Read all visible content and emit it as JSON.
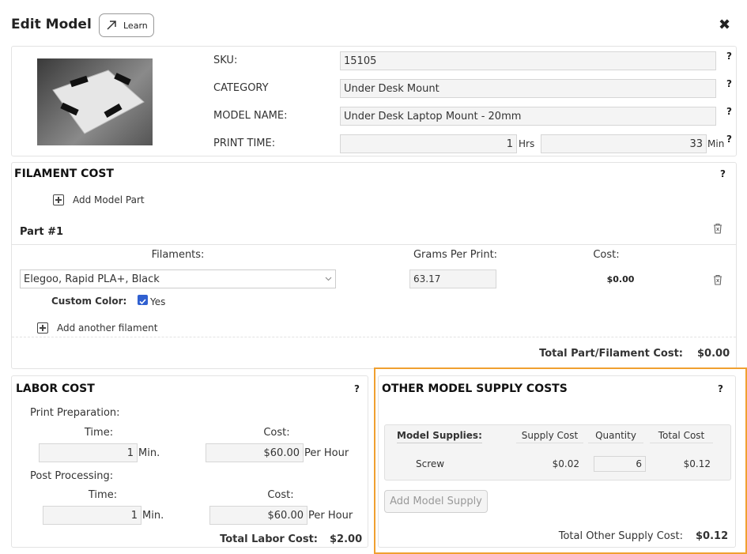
{
  "header": {
    "title": "Edit Model",
    "learn_label": "Learn",
    "close_symbol": "✖"
  },
  "info": {
    "sku_label": "SKU:",
    "sku_value": "15105",
    "category_label": "CATEGORY",
    "category_value": "Under Desk Mount",
    "model_name_label": "MODEL NAME:",
    "model_name_value": "Under Desk Laptop Mount - 20mm",
    "print_time_label": "PRINT TIME:",
    "hours_value": "1",
    "hours_unit": "Hrs",
    "minutes_value": "33",
    "minutes_unit": "Min",
    "help": "?"
  },
  "filament": {
    "title": "FILAMENT COST",
    "help": "?",
    "add_part_label": "Add Model Part",
    "part_title": "Part #1",
    "col_filaments": "Filaments:",
    "col_grams": "Grams Per Print:",
    "col_cost": "Cost:",
    "filament_selected": "Elegoo, Rapid PLA+, Black",
    "grams_value": "63.17",
    "cost_value": "$0.00",
    "custom_color_label": "Custom Color:",
    "custom_color_value": "Yes",
    "add_filament_label": "Add another filament",
    "total_label": "Total Part/Filament Cost:",
    "total_value": "$0.00"
  },
  "labor": {
    "title": "LABOR COST",
    "help": "?",
    "prep_label": "Print Preparation:",
    "time_label": "Time:",
    "cost_label": "Cost:",
    "prep_time": "1",
    "prep_time_unit": "Min.",
    "prep_cost": "$60.00",
    "prep_cost_unit": "Per Hour",
    "post_label": "Post Processing:",
    "post_time": "1",
    "post_time_unit": "Min.",
    "post_cost": "$60.00",
    "post_cost_unit": "Per Hour",
    "total_label": "Total Labor Cost:",
    "total_value": "$2.00"
  },
  "supplies": {
    "title": "OTHER MODEL SUPPLY COSTS",
    "help": "?",
    "col_supplies": "Model Supplies:",
    "col_supply_cost": "Supply Cost",
    "col_quantity": "Quantity",
    "col_total": "Total Cost",
    "rows": [
      {
        "name": "Screw",
        "supply_cost": "$0.02",
        "quantity": "6",
        "total": "$0.12"
      }
    ],
    "add_label": "Add Model Supply",
    "total_label": "Total Other Supply Cost:",
    "total_value": "$0.12",
    "highlight_color": "#f0a030"
  }
}
